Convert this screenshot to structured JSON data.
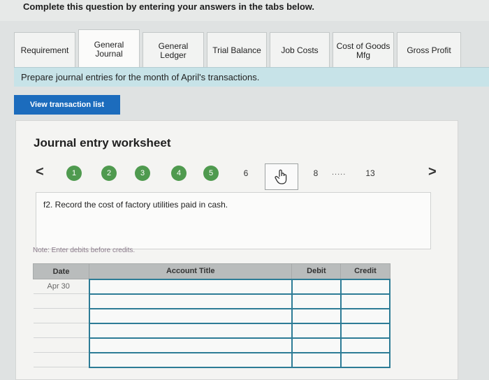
{
  "header": {
    "instruction": "Complete this question by entering your answers in the tabs below."
  },
  "tabs": [
    {
      "line1": "Requirement",
      "line2": ""
    },
    {
      "line1": "General",
      "line2": "Journal"
    },
    {
      "line1": "General",
      "line2": "Ledger"
    },
    {
      "line1": "Trial Balance",
      "line2": ""
    },
    {
      "line1": "Job Costs",
      "line2": ""
    },
    {
      "line1": "Cost of Goods",
      "line2": "Mfg"
    },
    {
      "line1": "Gross Profit",
      "line2": ""
    }
  ],
  "prepare_text": "Prepare journal entries for the month of April's transactions.",
  "view_button": "View transaction list",
  "worksheet": {
    "title": "Journal entry worksheet",
    "nav": {
      "prev": "<",
      "next": ">",
      "dots": ".....",
      "steps": [
        "1",
        "2",
        "3",
        "4",
        "5",
        "6",
        "8",
        "13"
      ]
    },
    "prompt": "f2. Record the cost of factory utilities paid in cash.",
    "note": "Note: Enter debits before credits.",
    "table": {
      "headers": [
        "Date",
        "Account Title",
        "Debit",
        "Credit"
      ],
      "first_date": "Apr 30"
    }
  },
  "colors": {
    "accent": "#1c6cbd",
    "step_done": "#4f9a4f",
    "prepare_bg": "#c7e3e8"
  }
}
